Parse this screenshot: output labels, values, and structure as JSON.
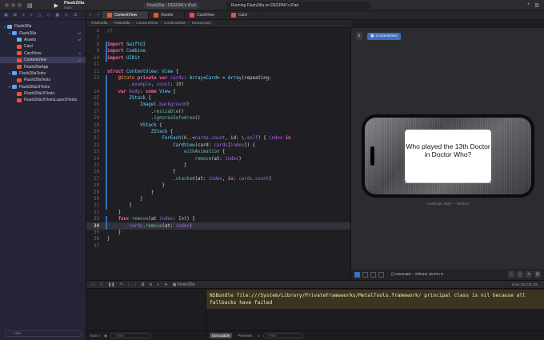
{
  "toolbar": {
    "project_name": "FlashZilla",
    "branch": "main",
    "scheme": "FlashZilla",
    "destination": "DEEPAK's iPad",
    "status": "Running FlashZilla on DEEPAK's iPad",
    "run_icon": "play-icon",
    "stop_icon": "stop-icon"
  },
  "tabs": [
    {
      "label": "ContentView",
      "active": true
    },
    {
      "label": "Assets",
      "active": false
    },
    {
      "label": "CardView",
      "active": false
    },
    {
      "label": "Card",
      "active": false
    }
  ],
  "breadcrumb": [
    "FlashZilla",
    "FlashZilla",
    "ContentView",
    "ContentView",
    "remove(at:)"
  ],
  "navigator": {
    "items": [
      {
        "label": "FlashZilla",
        "type": "project",
        "level": 0,
        "badge": "",
        "selected": false
      },
      {
        "label": "FlashZilla",
        "type": "folder",
        "level": 1,
        "badge": "M",
        "selected": false
      },
      {
        "label": "Assets",
        "type": "asset",
        "level": 2,
        "badge": "M",
        "selected": false
      },
      {
        "label": "Card",
        "type": "swift",
        "level": 2,
        "badge": "",
        "selected": false
      },
      {
        "label": "CardView",
        "type": "swift",
        "level": 2,
        "badge": "A",
        "selected": false
      },
      {
        "label": "ContentView",
        "type": "swift",
        "level": 2,
        "badge": "M",
        "selected": true
      },
      {
        "label": "FlashZillaApp",
        "type": "swift",
        "level": 2,
        "badge": "",
        "selected": false
      },
      {
        "label": "FlashZillaTests",
        "type": "folder",
        "level": 1,
        "badge": "",
        "selected": false
      },
      {
        "label": "FlashZillaTests",
        "type": "swift",
        "level": 2,
        "badge": "",
        "selected": false
      },
      {
        "label": "FlashZillaUITests",
        "type": "folder",
        "level": 1,
        "badge": "",
        "selected": false
      },
      {
        "label": "FlashZillaUITests",
        "type": "swift",
        "level": 2,
        "badge": "",
        "selected": false
      },
      {
        "label": "FlashZillaUITestsLaunchTests",
        "type": "swift",
        "level": 2,
        "badge": "",
        "selected": false
      }
    ],
    "filter_placeholder": "Filter"
  },
  "editor": {
    "current_line": 34,
    "lines": [
      {
        "n": "6",
        "code": "//"
      },
      {
        "n": "7",
        "code": ""
      },
      {
        "n": "8",
        "code": "import SwiftUI"
      },
      {
        "n": "9",
        "code": "import Combine"
      },
      {
        "n": "10",
        "code": "import UIKit"
      },
      {
        "n": "11",
        "code": ""
      },
      {
        "n": "12",
        "code": "struct ContentView: View {"
      },
      {
        "n": "13",
        "code": "    @State private var cards: Array<Card> = Array(repeating:"
      },
      {
        "n": "",
        "code": "        .example, count: 10)"
      },
      {
        "n": "14",
        "code": "    var body: some View {"
      },
      {
        "n": "15",
        "code": "        ZStack {"
      },
      {
        "n": "16",
        "code": "            Image(.background)"
      },
      {
        "n": "17",
        "code": "                .resizable()"
      },
      {
        "n": "18",
        "code": "                .ignoresSafeArea()"
      },
      {
        "n": "19",
        "code": "            VStack {"
      },
      {
        "n": "20",
        "code": "                ZStack {"
      },
      {
        "n": "21",
        "code": "                    ForEach(0..<cards.count, id: \\.self) { index in"
      },
      {
        "n": "22",
        "code": "                        CardView(card: cards[index]) {"
      },
      {
        "n": "23",
        "code": "                            withAnimation {"
      },
      {
        "n": "24",
        "code": "                                remove(at: index)"
      },
      {
        "n": "25",
        "code": "                            }"
      },
      {
        "n": "26",
        "code": "                        }"
      },
      {
        "n": "27",
        "code": "                        .stacked(at: index, in: cards.count)"
      },
      {
        "n": "28",
        "code": "                    }"
      },
      {
        "n": "29",
        "code": "                }"
      },
      {
        "n": "30",
        "code": "            }"
      },
      {
        "n": "31",
        "code": "        }"
      },
      {
        "n": "32",
        "code": "    }"
      },
      {
        "n": "33",
        "code": "    func remove(at index: Int) {"
      },
      {
        "n": "34",
        "code": "        cards.remove(at: index)"
      },
      {
        "n": "35",
        "code": "    }"
      },
      {
        "n": "36",
        "code": "}"
      },
      {
        "n": "37",
        "code": ""
      }
    ]
  },
  "preview": {
    "chip_label": "ContentView",
    "card_text": "Who played the 13th Doctor in Doctor Who?",
    "caption": "Landscape Right — Medium",
    "device": "Automatic – iPhone 16 Pro"
  },
  "debug": {
    "scheme_label": "FlashZilla",
    "line_col": "Line: 34  Col: 32"
  },
  "variables": {
    "mode": "Auto",
    "filter_placeholder": "Filter"
  },
  "console": {
    "message": "NSBundle file:///System/Library/PrivateFrameworks/MetalTools.framework/ principal class is nil because all fallbacks have failed",
    "seg_executable": "Executable",
    "seg_previews": "Previews",
    "filter_placeholder": "Filter"
  },
  "colors": {
    "accent": "#3d8cff",
    "sidebar_bg": "#262538",
    "editor_bg": "#1f1f23",
    "keyword": "#fc5fa3",
    "type": "#5dd8ff",
    "console_warning_bg": "#3b3520"
  }
}
